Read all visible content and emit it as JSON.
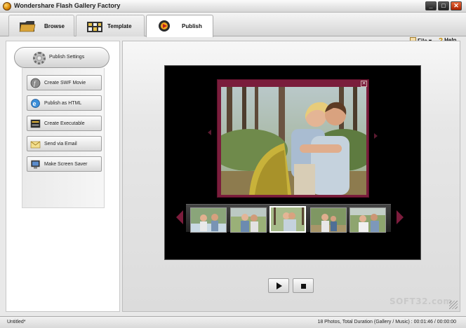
{
  "window": {
    "title": "Wondershare Flash Gallery Factory",
    "min_glyph": "_",
    "max_glyph": "□",
    "close_glyph": "✕"
  },
  "tabs": [
    {
      "label": "Browse",
      "icon": "folder-icon"
    },
    {
      "label": "Template",
      "icon": "template-icon"
    },
    {
      "label": "Publish",
      "icon": "publish-icon",
      "active": true
    }
  ],
  "menu": {
    "file": "File",
    "file_arrow": "▾",
    "help": "Help"
  },
  "left_panel": {
    "header": "Publish Settings",
    "items": [
      {
        "label": "Create SWF Movie",
        "icon": "swf-icon"
      },
      {
        "label": "Publish as HTML",
        "icon": "html-globe-icon"
      },
      {
        "label": "Create Executable",
        "icon": "executable-icon"
      },
      {
        "label": "Send via Email",
        "icon": "email-icon"
      },
      {
        "label": "Make Screen Saver",
        "icon": "screen-saver-icon"
      }
    ]
  },
  "preview": {
    "close_glyph": "✕",
    "thumbnails": 5,
    "selected_thumbnail": 3
  },
  "watermark": "SOFT32.com",
  "status": {
    "left": "Untitled*",
    "right": "18 Photos, Total Duration (Gallery / Music) : 00:01:46 / 00:00:00"
  },
  "colors": {
    "frame": "#7a1d3c",
    "stage": "#000000",
    "accent_arrow": "#7c1c3c"
  }
}
